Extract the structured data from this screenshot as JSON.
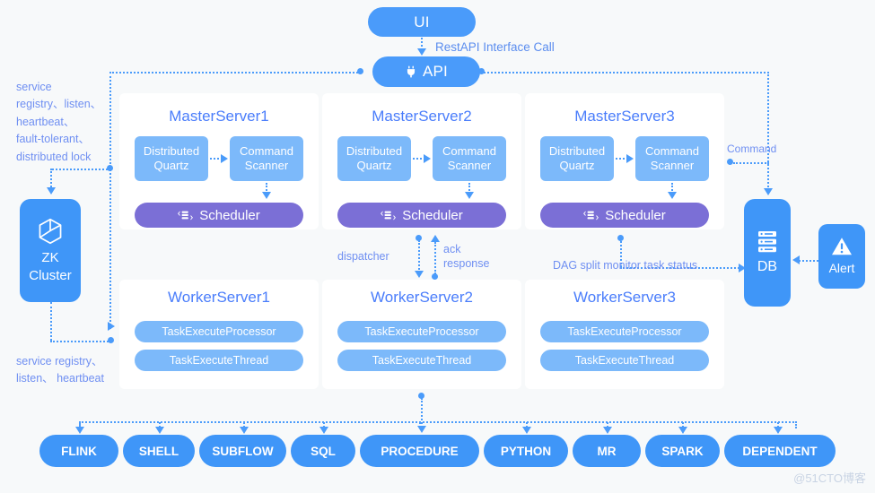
{
  "diagram": {
    "title": "Apache DolphinScheduler Architecture",
    "colors": {
      "background": "#f7f9fa",
      "primary_blue": "#3f96f8",
      "light_blue": "#7cb9fa",
      "purple": "#7b6fd6",
      "text_blue": "#4a7dfb",
      "note_blue": "#6f8ff2",
      "card_white": "#ffffff"
    },
    "top": {
      "ui_label": "UI",
      "api_label": "API",
      "api_icon": "plug-icon",
      "restapi_label": "RestAPI Interface Call"
    },
    "zk": {
      "line1": "ZK",
      "line2": "Cluster",
      "icon": "cube-icon"
    },
    "db": {
      "label": "DB",
      "icon": "database-icon"
    },
    "alert": {
      "label": "Alert",
      "icon": "warning-triangle-icon"
    },
    "master_servers": [
      {
        "title": "MasterServer1",
        "box1_line1": "Distributed",
        "box1_line2": "Quartz",
        "box2_line1": "Command",
        "box2_line2": "Scanner",
        "scheduler": "Scheduler",
        "scheduler_icon": "stack-arrows-icon"
      },
      {
        "title": "MasterServer2",
        "box1_line1": "Distributed",
        "box1_line2": "Quartz",
        "box2_line1": "Command",
        "box2_line2": "Scanner",
        "scheduler": "Scheduler",
        "scheduler_icon": "stack-arrows-icon"
      },
      {
        "title": "MasterServer3",
        "box1_line1": "Distributed",
        "box1_line2": "Quartz",
        "box2_line1": "Command",
        "box2_line2": "Scanner",
        "scheduler": "Scheduler",
        "scheduler_icon": "stack-arrows-icon"
      }
    ],
    "worker_servers": [
      {
        "title": "WorkerServer1",
        "pill1": "TaskExecuteProcessor",
        "pill2": "TaskExecuteThread"
      },
      {
        "title": "WorkerServer2",
        "pill1": "TaskExecuteProcessor",
        "pill2": "TaskExecuteThread"
      },
      {
        "title": "WorkerServer3",
        "pill1": "TaskExecuteProcessor",
        "pill2": "TaskExecuteThread"
      }
    ],
    "notes": {
      "zk_top": "service\nregistry、listen、\nheartbeat、\nfault-tolerant、\ndistributed lock",
      "zk_bottom": "service registry、\nlisten、 heartbeat",
      "dispatcher": "dispatcher",
      "ack_line1": "ack",
      "ack_line2": "response",
      "dag_monitor": "DAG split monitor task status",
      "command": "Command"
    },
    "task_types": [
      "FLINK",
      "SHELL",
      "SUBFLOW",
      "SQL",
      "PROCEDURE",
      "PYTHON",
      "MR",
      "SPARK",
      "DEPENDENT"
    ],
    "watermark": "@51CTO博客"
  }
}
